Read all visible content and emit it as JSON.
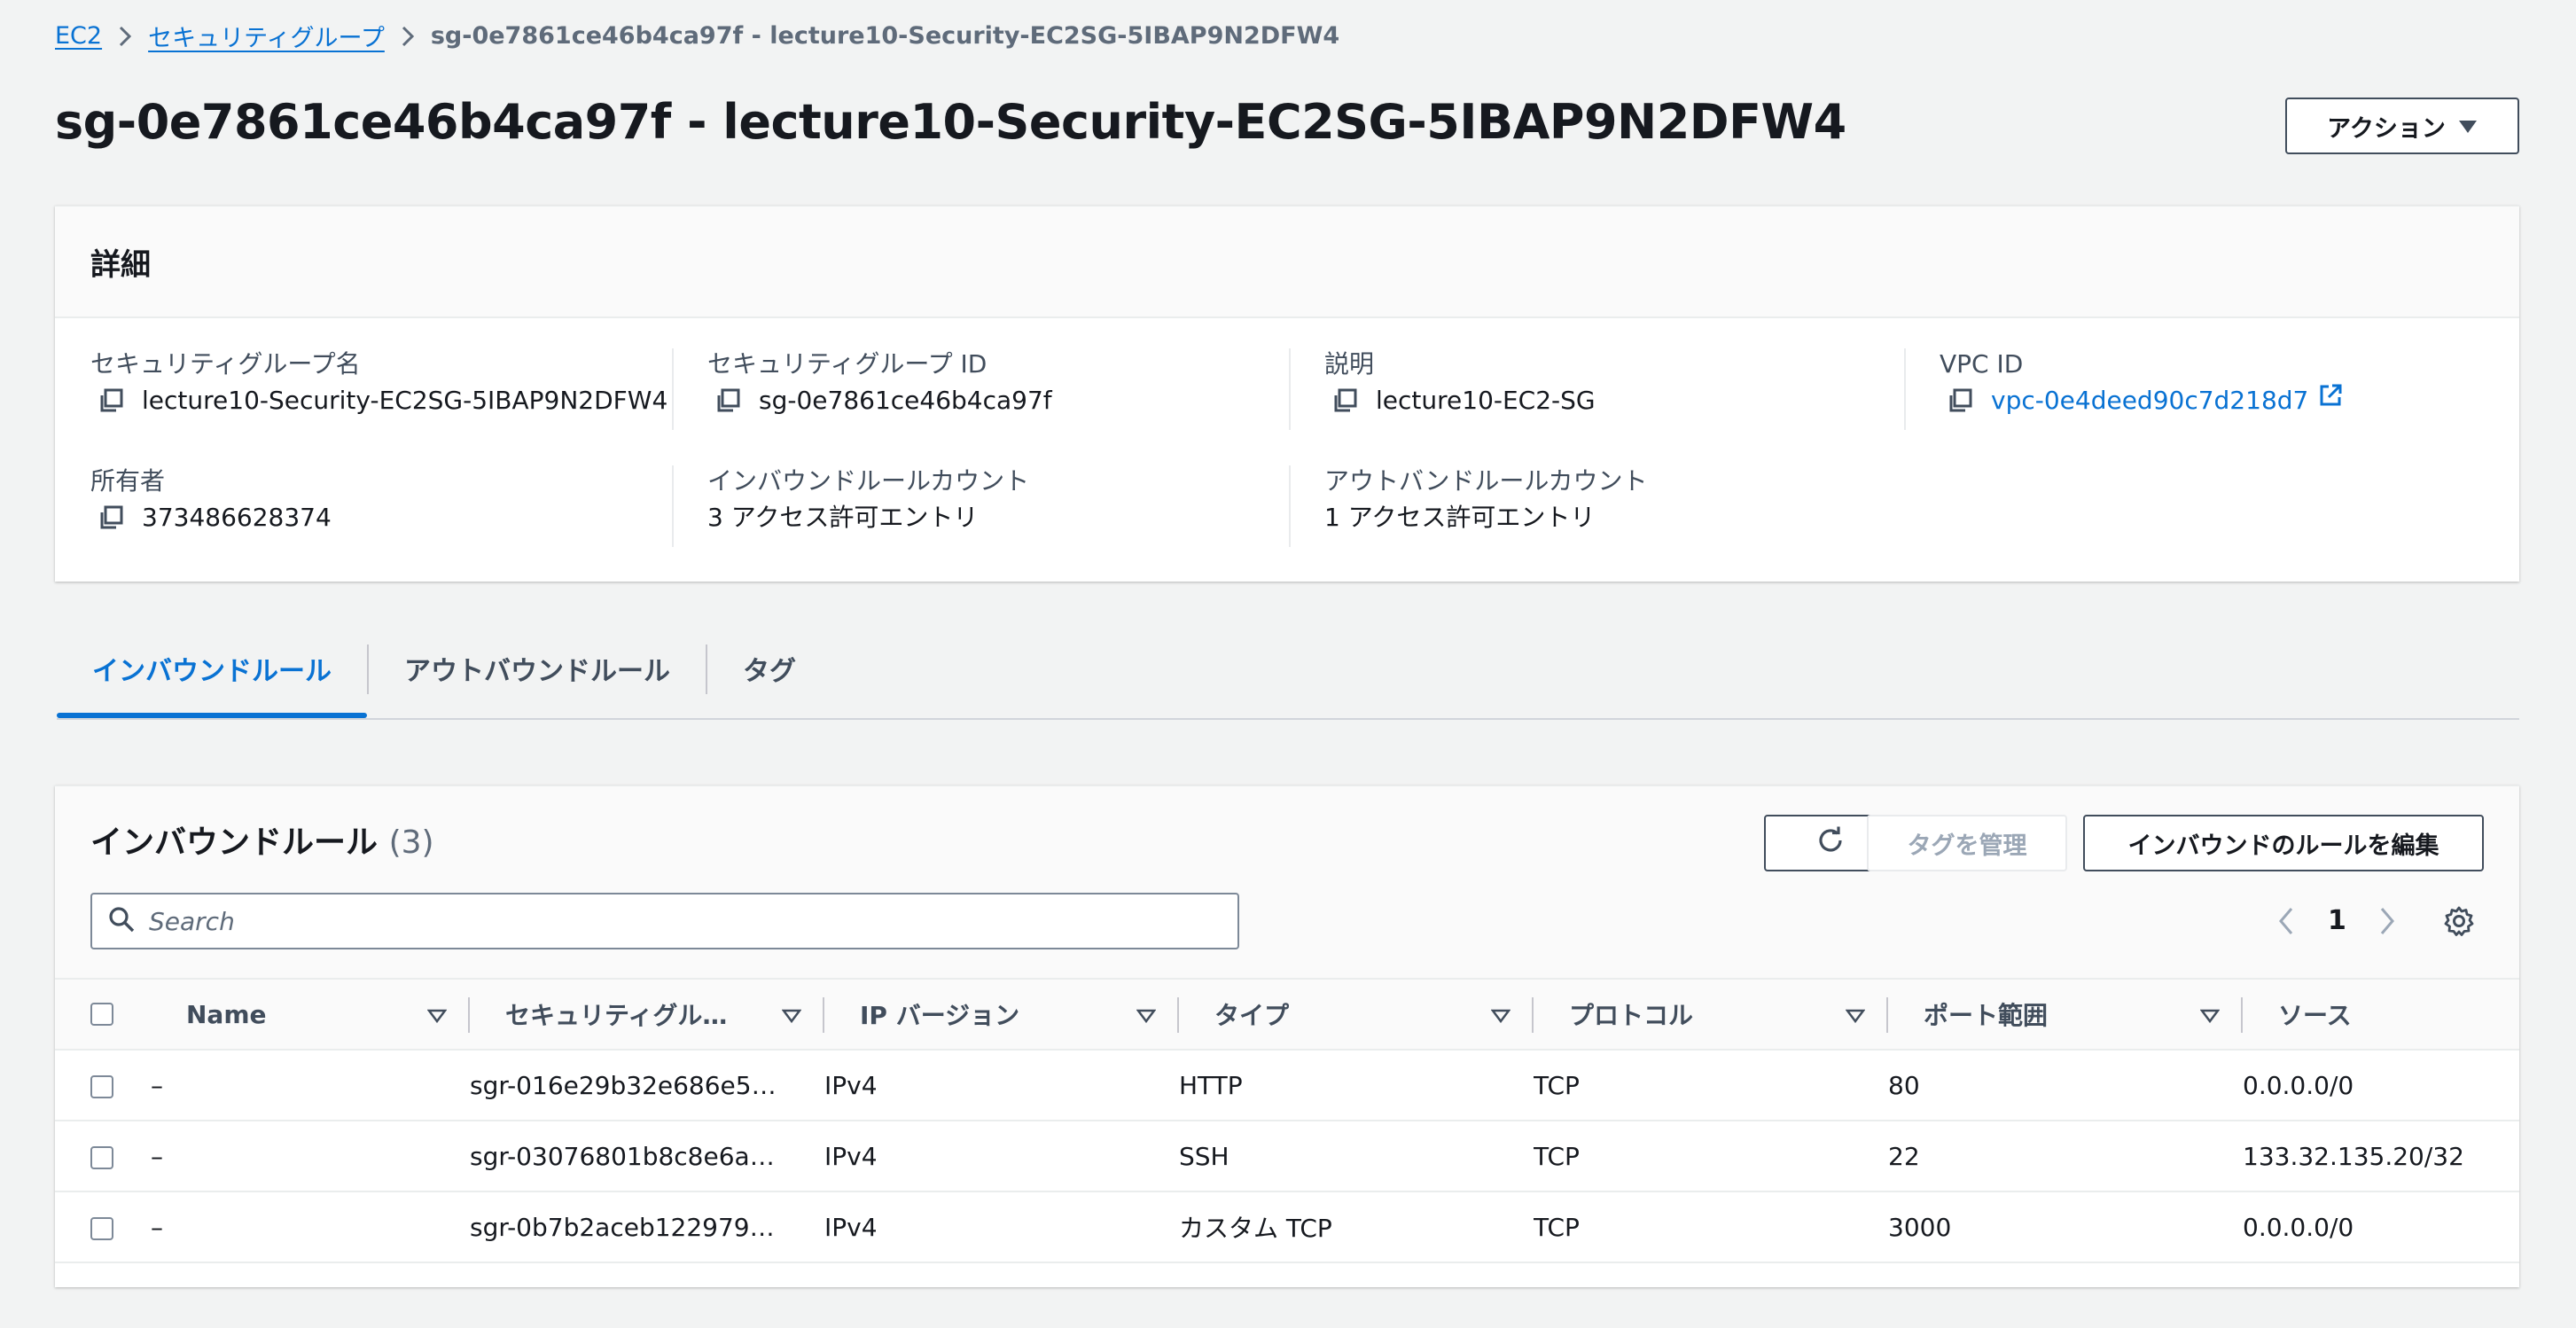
{
  "breadcrumb": {
    "ec2": "EC2",
    "security_groups": "セキュリティグループ",
    "current": "sg-0e7861ce46b4ca97f - lecture10-Security-EC2SG-5IBAP9N2DFW4"
  },
  "page": {
    "title": "sg-0e7861ce46b4ca97f - lecture10-Security-EC2SG-5IBAP9N2DFW4",
    "actions_label": "アクション"
  },
  "details": {
    "heading": "詳細",
    "sg_name_label": "セキュリティグループ名",
    "sg_name": "lecture10-Security-EC2SG-5IBAP9N2DFW4",
    "sg_id_label": "セキュリティグループ ID",
    "sg_id": "sg-0e7861ce46b4ca97f",
    "description_label": "説明",
    "description": "lecture10-EC2-SG",
    "vpc_id_label": "VPC ID",
    "vpc_id": "vpc-0e4deed90c7d218d7",
    "owner_label": "所有者",
    "owner": "373486628374",
    "inbound_count_label": "インバウンドルールカウント",
    "inbound_count": "3 アクセス許可エントリ",
    "outbound_count_label": "アウトバンドルールカウント",
    "outbound_count": "1 アクセス許可エントリ"
  },
  "tabs": [
    {
      "label": "インバウンドルール"
    },
    {
      "label": "アウトバウンドルール"
    },
    {
      "label": "タグ"
    }
  ],
  "rules": {
    "title": "インバウンドルール",
    "count": "(3)",
    "manage_tags_label": "タグを管理",
    "edit_rules_label": "インバウンドのルールを編集",
    "search_placeholder": "Search",
    "page_number": "1",
    "columns": [
      "Name",
      "セキュリティグル…",
      "IP バージョン",
      "タイプ",
      "プロトコル",
      "ポート範囲",
      "ソース"
    ],
    "rows": [
      {
        "name": "–",
        "rule_id": "sgr-016e29b32e686e5…",
        "ip_version": "IPv4",
        "type": "HTTP",
        "protocol": "TCP",
        "port_range": "80",
        "source": "0.0.0.0/0"
      },
      {
        "name": "–",
        "rule_id": "sgr-03076801b8c8e6a…",
        "ip_version": "IPv4",
        "type": "SSH",
        "protocol": "TCP",
        "port_range": "22",
        "source": "133.32.135.20/32"
      },
      {
        "name": "–",
        "rule_id": "sgr-0b7b2aceb122979…",
        "ip_version": "IPv4",
        "type": "カスタム TCP",
        "protocol": "TCP",
        "port_range": "3000",
        "source": "0.0.0.0/0"
      }
    ]
  },
  "colors": {
    "link": "#0972d3",
    "background": "#f2f3f3",
    "text": "#16191f"
  }
}
